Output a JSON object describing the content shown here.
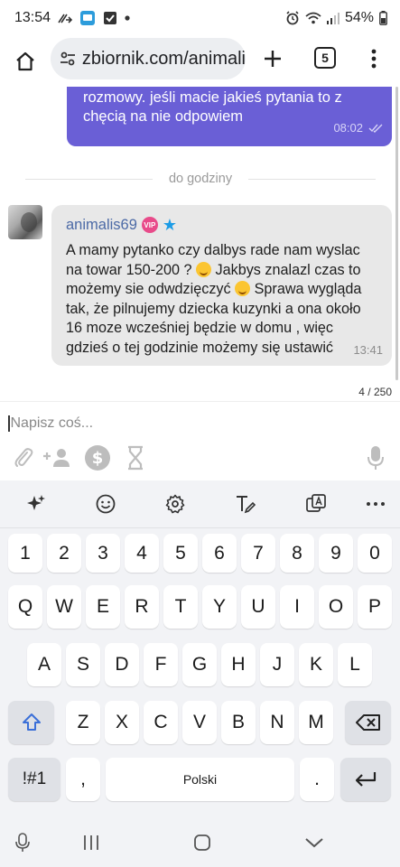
{
  "status_bar": {
    "time": "13:54",
    "battery": "54%"
  },
  "browser": {
    "url": "zbiornik.com/animali",
    "tab_count": "5"
  },
  "chat": {
    "outgoing_message": {
      "text": "rozmowy. jeśli macie jakieś pytania to z chęcią na nie odpowiem",
      "time": "08:02"
    },
    "divider_label": "do godziny",
    "incoming_message": {
      "author": "animalis69",
      "badge": "VIP",
      "text_part1": "A mamy pytanko czy dalbys rade nam wyslac na towar 150-200 ? ",
      "text_part2": " Jakbys znalazl czas to możemy sie odwdzięczyć ",
      "text_part3": " Sprawa wygląda tak, że pilnujemy dziecka kuzynki a ona około  16 moze wcześniej będzie w domu , więc gdzieś o tej godzinie możemy się ustawić",
      "time": "13:41"
    },
    "char_counter": "4 / 250"
  },
  "compose": {
    "placeholder": "Napisz coś..."
  },
  "keyboard": {
    "number_row": [
      "1",
      "2",
      "3",
      "4",
      "5",
      "6",
      "7",
      "8",
      "9",
      "0"
    ],
    "row1": [
      "Q",
      "W",
      "E",
      "R",
      "T",
      "Y",
      "U",
      "I",
      "O",
      "P"
    ],
    "row2": [
      "A",
      "S",
      "D",
      "F",
      "G",
      "H",
      "J",
      "K",
      "L"
    ],
    "row3": [
      "Z",
      "X",
      "C",
      "V",
      "B",
      "N",
      "M"
    ],
    "symbols_key": "!#1",
    "comma_key": ",",
    "space_label": "Polski",
    "period_key": "."
  }
}
